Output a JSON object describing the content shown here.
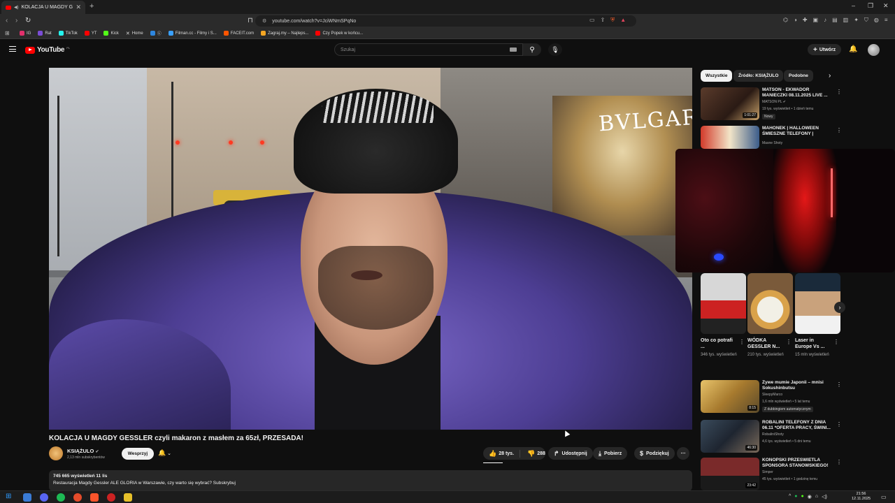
{
  "browser": {
    "tab_title": "KOLACJA U MAGDY GESSLER",
    "url": "youtube.com/watch?v=JciWNmSPqNo",
    "bookmarks": [
      {
        "label": "IG",
        "color": "#e1306c"
      },
      {
        "label": "Rat",
        "color": "#7b4dd6"
      },
      {
        "label": "TikTok",
        "color": "#25f4ee"
      },
      {
        "label": "YT",
        "color": "#ff0000"
      },
      {
        "label": "Kick",
        "color": "#53fc18"
      },
      {
        "label": "Home",
        "color": "#ffffff"
      },
      {
        "label": "Ⓛ",
        "color": "#2e86de"
      },
      {
        "label": "Filman.cc - Filmy i S...",
        "color": "#3aa0ff"
      },
      {
        "label": "FACEIT.com",
        "color": "#ff5500"
      },
      {
        "label": "Zagraj.my – Najleps...",
        "color": "#f5a623"
      },
      {
        "label": "Czy Popek w końcu...",
        "color": "#ff0000"
      }
    ]
  },
  "youtube": {
    "logo_text": "YouTube",
    "region": "PL",
    "search_placeholder": "Szukaj",
    "create_label": "Utwórz"
  },
  "video": {
    "title": "KOLACJA U MAGDY GESSLER czyli makaron z masłem za 65zł, PRZESADA!",
    "channel": "KSIĄŻULO",
    "subscribers": "2,13 mln subskrybentów",
    "join_label": "Wesprzyj",
    "likes": "28 tys.",
    "dislikes": "288",
    "share_label": "Udostępnij",
    "download_label": "Pobierz",
    "thanks_label": "Podziękuj",
    "views_date": "745 665 wyświetleń  11 lis",
    "description": "Restauracja Magdy Gessler ALE GLORIA w Warszawie, czy warto się wybrać? Subskrybuj"
  },
  "chips": [
    "Wszystkie",
    "Źródło: KSIĄŻULO",
    "Podobne"
  ],
  "recommendations_top": [
    {
      "title": "MATSON - EKWADOR MANIECZKI 08.11.2025 LIVE ...",
      "channel": "MATSON PL",
      "views": "19 tys. wyświetleń • 1 dzień temu",
      "badge": "Nowy",
      "duration": "1:01:27"
    },
    {
      "title": "MAHONEK | HALLOWEEN ŚMIESZNE TELEFONY |",
      "channel": "Masne Shoty",
      "views": "",
      "badge": "",
      "duration": ""
    }
  ],
  "shorts": [
    {
      "title": "Oto co potrafi ...",
      "views": "346 tys. wyświetleń"
    },
    {
      "title": "WÓDKA GESSLER N...",
      "views": "210 tys. wyświetleń"
    },
    {
      "title": "Laser in Europe Vs ...",
      "views": "15 mln wyświetleń"
    }
  ],
  "recommendations_bottom": [
    {
      "title": "Żywe mumie Japonii – mnisi Sokushinbutsu",
      "channel": "SleepyMarco",
      "views": "1,6 mln wyświetleń • 5 lat temu",
      "badge": "Z dubbingiem automatycznym",
      "duration": "8:15"
    },
    {
      "title": "ROBALINI TELEFONY Z DNIA 06.11 *OFERTA PRACY, ŚWINI...",
      "channel": "RobaliniShoty",
      "views": "4,6 tys. wyświetleń • 5 dni temu",
      "badge": "",
      "duration": "46:30"
    },
    {
      "title": "KONOPSKI PRZEŚWIETLA SPONSORA STANOWSKIEGO!",
      "channel": "Simper",
      "views": "45 tys. wyświetleń • 1 godzinę temu",
      "badge": "",
      "duration": "23:42"
    }
  ],
  "taskbar": {
    "time": "21:56",
    "date": "12.11.2025"
  }
}
